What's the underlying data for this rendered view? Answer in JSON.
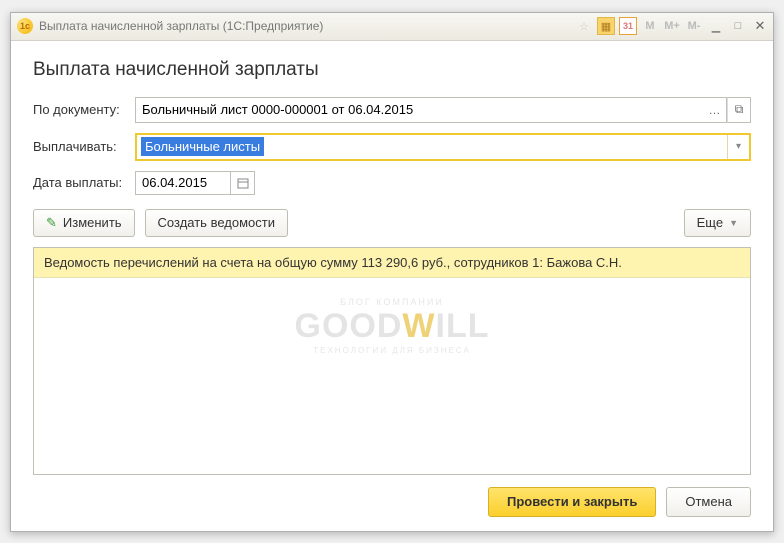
{
  "window": {
    "title": "Выплата начисленной зарплаты  (1С:Предприятие)"
  },
  "form": {
    "heading": "Выплата начисленной зарплаты",
    "document_label": "По документу:",
    "document_value": "Больничный лист 0000-000001 от 06.04.2015",
    "pay_label": "Выплачивать:",
    "pay_value": "Больничные листы",
    "date_label": "Дата выплаты:",
    "date_value": "06.04.2015"
  },
  "toolbar": {
    "edit_label": "Изменить",
    "create_label": "Создать ведомости",
    "more_label": "Еще"
  },
  "list": {
    "rows": [
      "Ведомость перечислений на счета на общую сумму 113 290,6 руб., сотрудников 1: Бажова С.Н."
    ]
  },
  "footer": {
    "ok_label": "Провести  и закрыть",
    "cancel_label": "Отмена"
  },
  "watermark": {
    "top": "БЛОГ КОМПАНИИ",
    "brand1": "GOOD",
    "brand2": "W",
    "brand3": "ILL",
    "tag": "ТЕХНОЛОГИИ  ДЛЯ  БИЗНЕСА"
  },
  "titlebar_icons": {
    "calc": "▦",
    "cal": "31",
    "m": "M",
    "min": "—",
    "max": "□",
    "close": "✕",
    "star": "☆"
  }
}
